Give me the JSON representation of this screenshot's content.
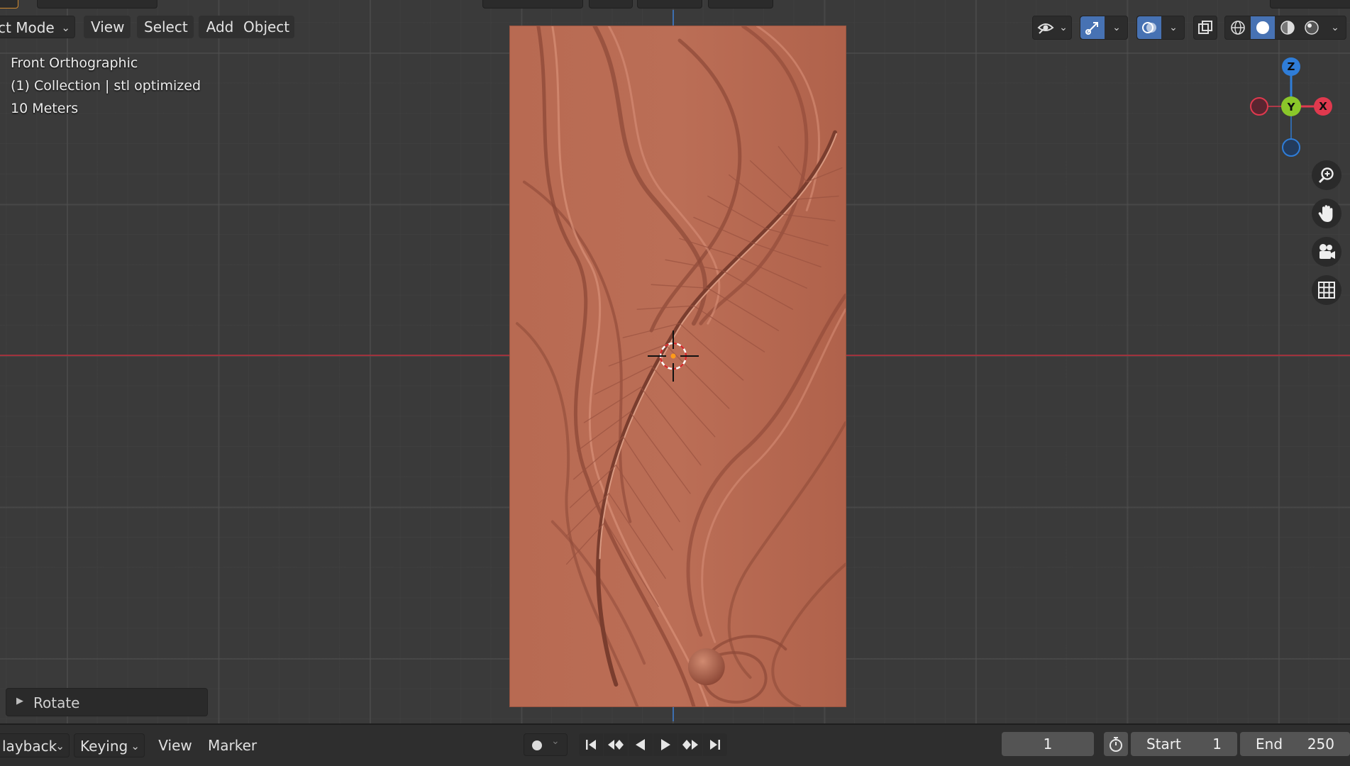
{
  "header": {
    "mode_label": "ct Mode",
    "menu": {
      "view": "View",
      "select": "Select",
      "add": "Add",
      "object": "Object"
    }
  },
  "viewport": {
    "view_name": "Front Orthographic",
    "collection_info": "(1) Collection | stl optimized",
    "scale_label": "10 Meters",
    "axis_colors": {
      "x": "#e0394e",
      "y": "#8ac72a",
      "z": "#2f7dd8"
    },
    "gizmo_labels": {
      "z": "Z",
      "y": "Y",
      "x": "X"
    },
    "object_color": "#b56a52"
  },
  "operator_panel": {
    "label": "Rotate"
  },
  "timeline": {
    "playback": "layback",
    "keying": "Keying",
    "view": "View",
    "marker": "Marker",
    "current_frame": "1",
    "start_label": "Start",
    "start_value": "1",
    "end_label": "End",
    "end_value": "250"
  },
  "icons": [
    "visibility-eye-icon",
    "gizmo-arrow-icon",
    "overlay-icon",
    "xray-icon",
    "wireframe-shading-icon",
    "solid-shading-icon",
    "material-shading-icon",
    "rendered-shading-icon",
    "zoom-icon",
    "pan-hand-icon",
    "camera-icon",
    "ortho-grid-icon",
    "record-icon",
    "jump-start-icon",
    "prev-keyframe-icon",
    "play-reverse-icon",
    "play-icon",
    "next-keyframe-icon",
    "jump-end-icon",
    "stopwatch-icon"
  ]
}
